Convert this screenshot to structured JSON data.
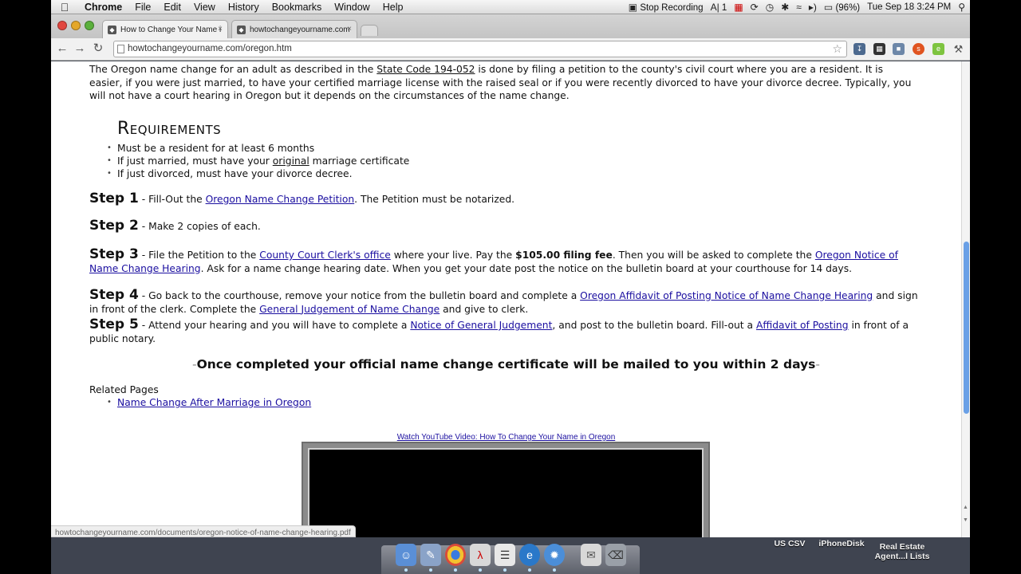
{
  "menubar": {
    "app": "Chrome",
    "items": [
      "File",
      "Edit",
      "View",
      "History",
      "Bookmarks",
      "Window",
      "Help"
    ],
    "stop_recording": "Stop Recording",
    "status_number": "1",
    "battery": "(96%)",
    "datetime": "Tue Sep 18  3:24 PM"
  },
  "tabs": [
    {
      "title": "How to Change Your Name i"
    },
    {
      "title": "howtochangeyourname.com"
    }
  ],
  "omnibox": {
    "url": "howtochangeyourname.com/oregon.htm"
  },
  "page": {
    "intro": {
      "p1": "The Oregon name change for an adult as described in the ",
      "link": "State Code 194-052",
      "p2": " is done by filing a petition to the county's civil court where you are a resident. It is easier, if you were just married, to have your certified marriage license with the raised seal or if you were recently divorced to have your divorce decree. Typically, you will not have a court hearing in Oregon but it depends on the circumstances of the name change."
    },
    "requirements_heading": "Requirements",
    "requirements": {
      "r1": "Must be a resident for at least 6 months",
      "r2a": "If just married, must have your ",
      "r2u": "original",
      "r2b": " marriage certificate",
      "r3": "If just divorced, must have your divorce decree."
    },
    "step1": {
      "label": "Step 1",
      "t1": " - Fill-Out the ",
      "l1": "Oregon Name Change Petition",
      "t2": ". The Petition must be notarized."
    },
    "step2": {
      "label": "Step 2",
      "t1": " - Make 2 copies of each."
    },
    "step3": {
      "label": "Step 3",
      "t1": " - File the Petition to the ",
      "l1": "County Court Clerk's office",
      "t2": " where your live. Pay the ",
      "b1": "$105.00 filing fee",
      "t3": ". Then you will be asked to complete the ",
      "l2": "Oregon Notice of Name Change Hearing",
      "t4": ". Ask for a name change hearing date. When you get your date post the notice on the bulletin board at your courthouse for 14 days."
    },
    "step4": {
      "label": "Step 4",
      "t1": " - Go back to the courthouse, remove your notice from the bulletin board and complete a ",
      "l1": "Oregon Affidavit of Posting Notice of Name Change Hearing",
      "t2": " and sign in front of the clerk. Complete the ",
      "l2": "General Judgement of Name Change",
      "t3": " and give to clerk."
    },
    "step5": {
      "label": "Step 5",
      "t1": " - Attend your hearing and you will have to complete a ",
      "l1": "Notice of General Judgement",
      "t2": ", and post to the bulletin board. Fill-out a ",
      "l2": "Affidavit of Posting",
      "t3": " in front of a public notary."
    },
    "completion": "Once completed your official name change certificate will be mailed to you within 2 days",
    "completion_dash": "-",
    "related_heading": "Related Pages",
    "related_link": "Name Change After Marriage in Oregon",
    "youtube_link": "Watch YouTube Video: How To Change Your Name in Oregon",
    "status_url": "howtochangeyourname.com/documents/oregon-notice-of-name-change-hearing.pdf"
  },
  "dock": {
    "labels": [
      "US CSV",
      "iPhoneDisk",
      "Real Estate Agent...l Lists"
    ]
  }
}
